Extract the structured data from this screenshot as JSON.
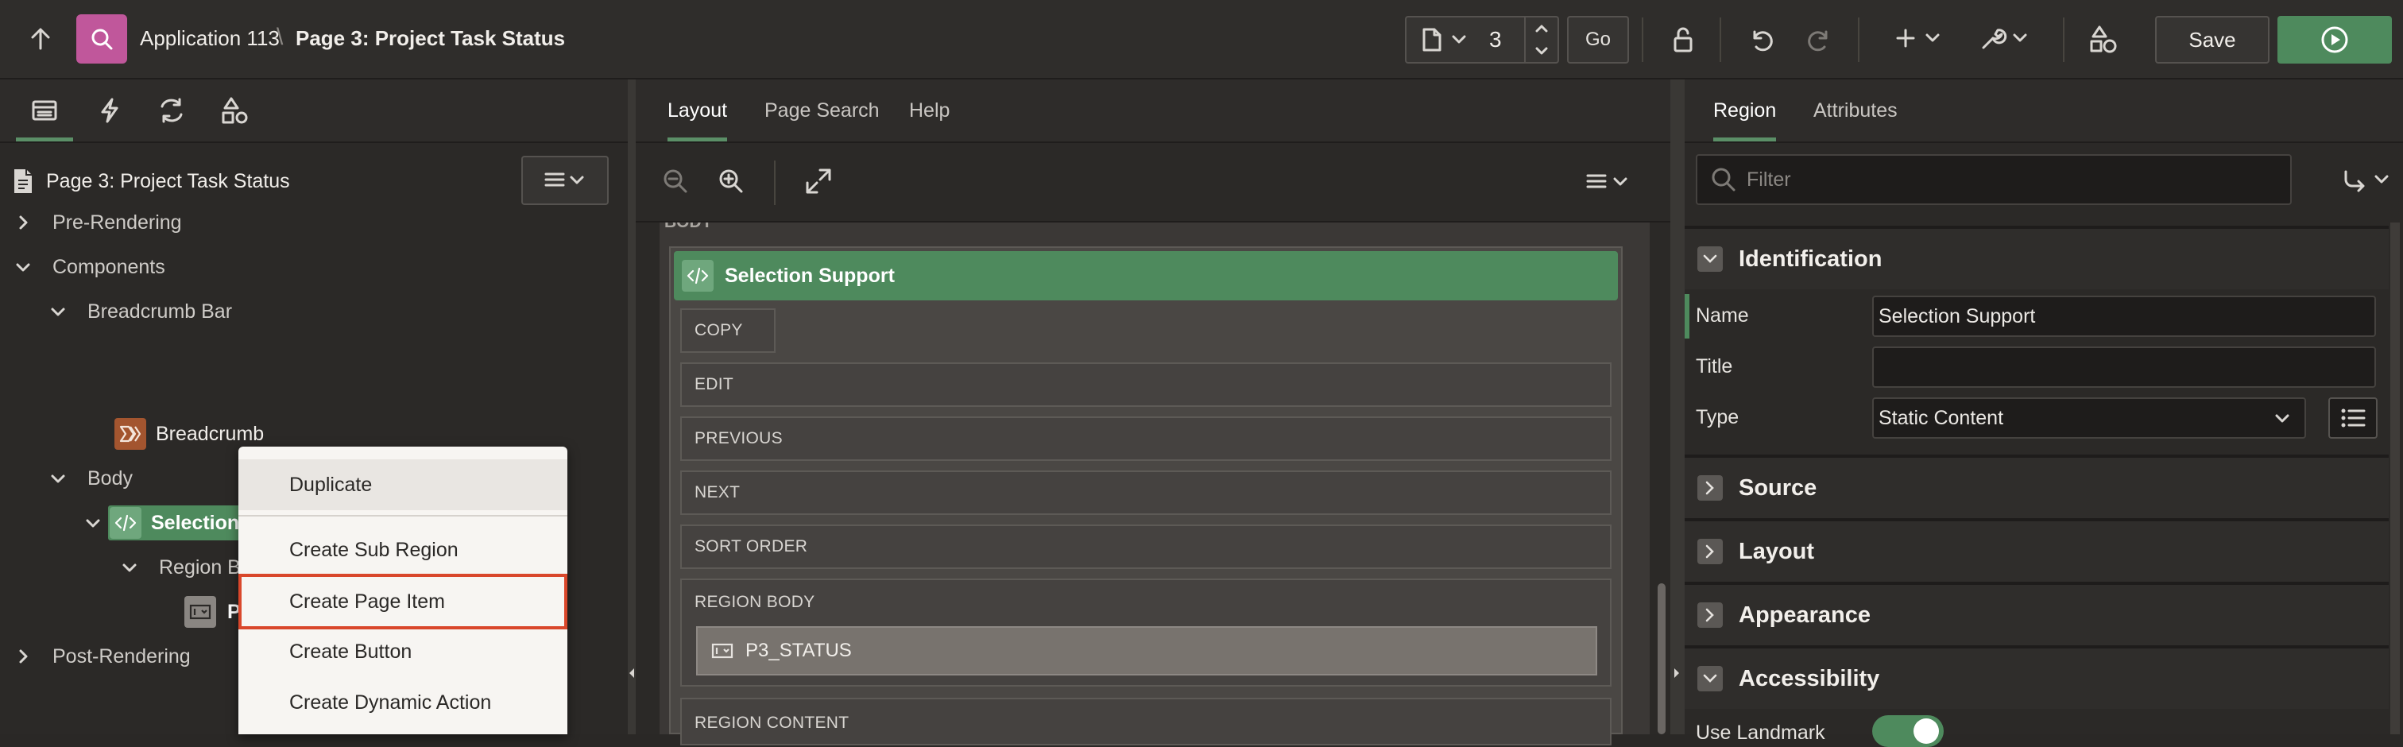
{
  "header": {
    "app_name": "Application 113",
    "separator": "\\",
    "page_title": "Page 3: Project Task Status",
    "page_number": "3",
    "go_label": "Go",
    "save_label": "Save"
  },
  "left_panel": {
    "tabs": [
      "rendering-icon",
      "dynamic-actions-icon",
      "processing-icon",
      "shared-components-icon"
    ],
    "root_label": "Page 3: Project Task Status",
    "tree": {
      "pre_rendering": "Pre-Rendering",
      "components": "Components",
      "breadcrumb_bar": "Breadcrumb Bar",
      "breadcrumb": "Breadcrumb",
      "body": "Body",
      "selection_support": "Selection Support",
      "region_body": "Region Bo",
      "item_partial": "P",
      "post_rendering": "Post-Rendering"
    }
  },
  "context_menu": {
    "items": [
      "Duplicate",
      "Create Sub Region",
      "Create Page Item",
      "Create Button",
      "Create Dynamic Action"
    ],
    "highlighted": "Create Page Item"
  },
  "center_panel": {
    "tabs": [
      "Layout",
      "Page Search",
      "Help"
    ],
    "active_tab": "Layout",
    "body_label": "BODY",
    "region_title": "Selection Support",
    "slots": [
      "COPY",
      "EDIT",
      "PREVIOUS",
      "NEXT",
      "SORT ORDER"
    ],
    "region_body_label": "REGION BODY",
    "item_label": "P3_STATUS",
    "region_content_label": "REGION CONTENT"
  },
  "right_panel": {
    "tabs": [
      "Region",
      "Attributes"
    ],
    "active_tab": "Region",
    "filter_placeholder": "Filter",
    "sections": {
      "identification": "Identification",
      "source": "Source",
      "layout": "Layout",
      "appearance": "Appearance",
      "accessibility": "Accessibility"
    },
    "props": {
      "name_label": "Name",
      "name_value": "Selection Support",
      "title_label": "Title",
      "title_value": "",
      "type_label": "Type",
      "type_value": "Static Content",
      "use_landmark_label": "Use Landmark"
    }
  },
  "colors": {
    "accent_green": "#4e8a5d",
    "highlight_red": "#d9472b",
    "app_icon_pink": "#c0579b"
  }
}
